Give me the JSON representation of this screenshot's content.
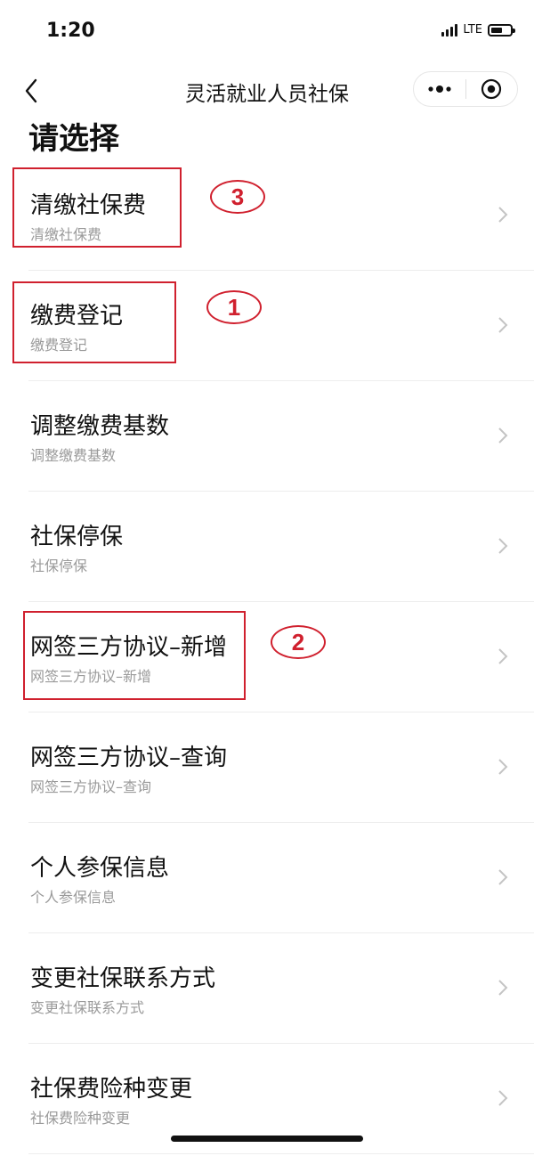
{
  "status_bar": {
    "time": "1:20",
    "network": "LTE",
    "battery_level": 0.6
  },
  "nav": {
    "title": "灵活就业人员社保",
    "icons": [
      "back-icon",
      "more-icon",
      "record-icon"
    ]
  },
  "heading": "请选择",
  "items": [
    {
      "title": "清缴社保费",
      "subtitle": "清缴社保费",
      "step": "3"
    },
    {
      "title": "缴费登记",
      "subtitle": "缴费登记",
      "step": "1"
    },
    {
      "title": "调整缴费基数",
      "subtitle": "调整缴费基数"
    },
    {
      "title": "社保停保",
      "subtitle": "社保停保"
    },
    {
      "title": "网签三方协议–新增",
      "subtitle": "网签三方协议–新增",
      "step": "2"
    },
    {
      "title": "网签三方协议–查询",
      "subtitle": "网签三方协议–查询"
    },
    {
      "title": "个人参保信息",
      "subtitle": "个人参保信息"
    },
    {
      "title": "变更社保联系方式",
      "subtitle": "变更社保联系方式"
    },
    {
      "title": "社保费险种变更",
      "subtitle": "社保费险种变更"
    }
  ],
  "colors": {
    "annotation_red": "#d0202e",
    "subtitle_gray": "#9a9a9a",
    "separator": "#ededed"
  }
}
